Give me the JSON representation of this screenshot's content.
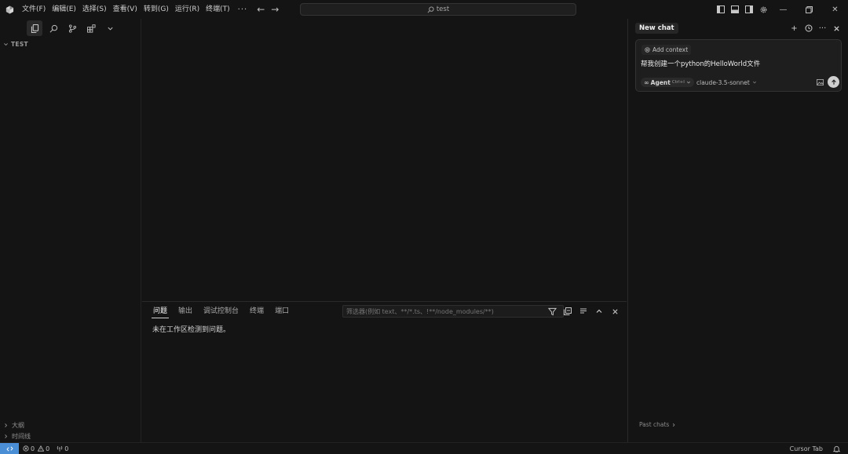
{
  "titlebar": {
    "menus": [
      "文件(F)",
      "编辑(E)",
      "选择(S)",
      "查看(V)",
      "转到(G)",
      "运行(R)",
      "终端(T)"
    ],
    "more": "···",
    "search_text": "test"
  },
  "sidebar": {
    "section_title": "TEST",
    "outline_label": "大纲",
    "timeline_label": "时间线"
  },
  "panel": {
    "tabs": [
      "问题",
      "输出",
      "调试控制台",
      "终端",
      "端口"
    ],
    "active_tab": "问题",
    "filter_placeholder": "筛选器(例如 text、**/*.ts、!**/node_modules/**)",
    "message": "未在工作区检测到问题。"
  },
  "chat": {
    "tab_title": "New chat",
    "add_context": "Add context",
    "prompt": "帮我创建一个python的HelloWorld文件",
    "agent_label": "Agent",
    "agent_shortcut": "Ctrl+I",
    "model": "claude-3.5-sonnet",
    "past_chats": "Past chats"
  },
  "statusbar": {
    "errors": "0",
    "warnings": "0",
    "ports": "0",
    "cursor_tab": "Cursor Tab"
  },
  "colors": {
    "background": "#141414",
    "remote_accent": "#4a8fd6",
    "border": "#2a2a2a"
  }
}
